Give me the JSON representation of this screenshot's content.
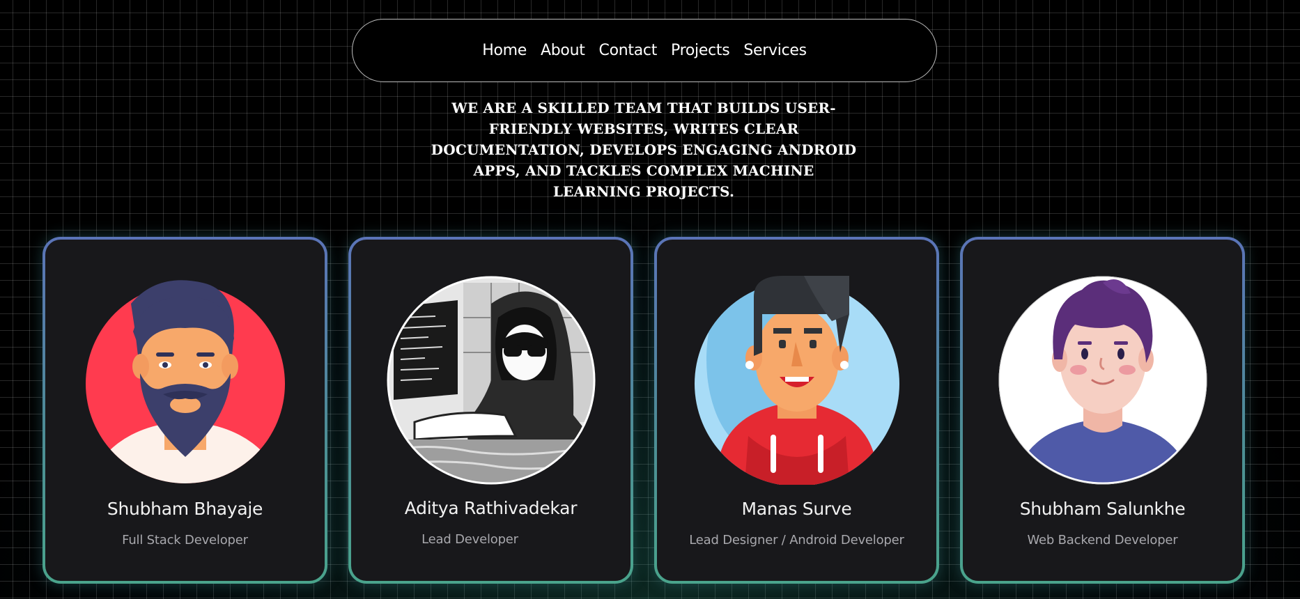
{
  "nav": {
    "items": [
      "Home",
      "About",
      "Contact",
      "Projects",
      "Services"
    ]
  },
  "hero": {
    "tagline": "WE ARE A SKILLED TEAM THAT BUILDS USER-FRIENDLY WEBSITES, WRITES CLEAR DOCUMENTATION, DEVELOPS ENGAGING ANDROID APPS, AND TACKLES COMPLEX MACHINE LEARNING PROJECTS."
  },
  "team": [
    {
      "name": "Shubham Bhayaje",
      "role": "Full Stack Developer",
      "avatar_icon": "bearded-man-avatar"
    },
    {
      "name": "Aditya Rathivadekar",
      "role": "Lead Developer",
      "avatar_icon": "hooded-coder-avatar"
    },
    {
      "name": "Manas Surve",
      "role": "Lead Designer / Android Developer",
      "avatar_icon": "smiling-man-hoodie-avatar"
    },
    {
      "name": "Shubham Salunkhe",
      "role": "Web Backend Developer",
      "avatar_icon": "purple-hair-avatar"
    }
  ],
  "colors": {
    "background": "#000000",
    "card": "#18181b",
    "border_top": "#5b74b8",
    "border_bottom": "#4aa48c",
    "text": "#ffffff",
    "muted": "#a8a8ad"
  }
}
